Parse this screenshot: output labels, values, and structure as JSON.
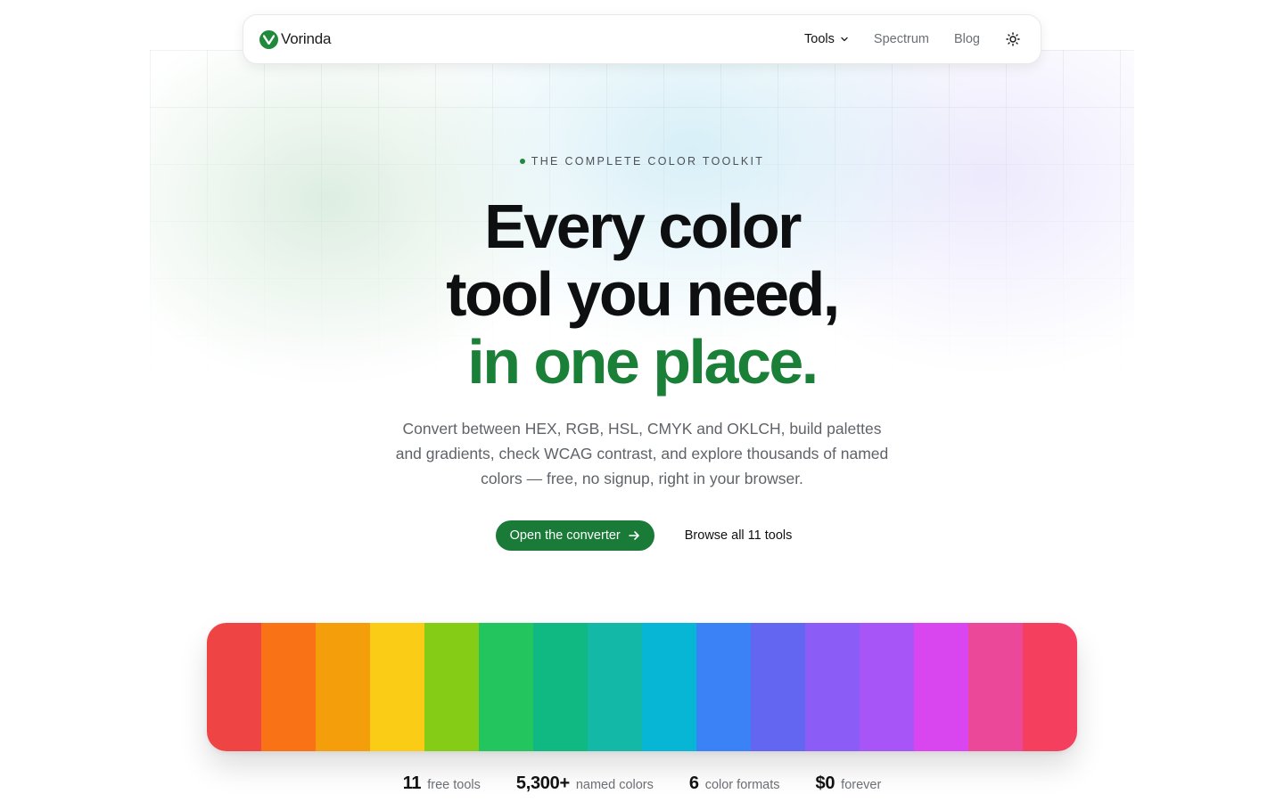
{
  "brand": {
    "name": "Vorinda",
    "logo_icon": "v-check-icon",
    "color": "#1f8a3b"
  },
  "nav": {
    "items": [
      {
        "label": "Tools",
        "active": true,
        "has_dropdown": true
      },
      {
        "label": "Spectrum"
      },
      {
        "label": "Blog"
      }
    ],
    "theme_toggle_icon": "sun-icon"
  },
  "hero": {
    "eyebrow": "THE COMPLETE COLOR TOOLKIT",
    "headline_line1": "Every color",
    "headline_line2": "tool you need,",
    "headline_accent": "in one place.",
    "subtitle": "Convert between HEX, RGB, HSL, CMYK and OKLCH, build palettes and gradients, check WCAG contrast, and explore thousands of named colors — free, no signup, right in your browser.",
    "primary_cta": "Open the converter",
    "secondary_cta": "Browse all 11 tools",
    "accent_color": "#1a7f37"
  },
  "spectrum": {
    "colors": [
      "#ef4444",
      "#f97316",
      "#f59e0b",
      "#facc15",
      "#84cc16",
      "#22c55e",
      "#10b981",
      "#14b8a6",
      "#06b6d4",
      "#3b82f6",
      "#6366f1",
      "#8b5cf6",
      "#a855f7",
      "#d946ef",
      "#ec4899",
      "#f43f5e"
    ]
  },
  "stats": [
    {
      "value": "11",
      "label": "free tools"
    },
    {
      "value": "5,300+",
      "label": "named colors"
    },
    {
      "value": "6",
      "label": "color formats"
    },
    {
      "value": "$0",
      "label": "forever"
    }
  ]
}
